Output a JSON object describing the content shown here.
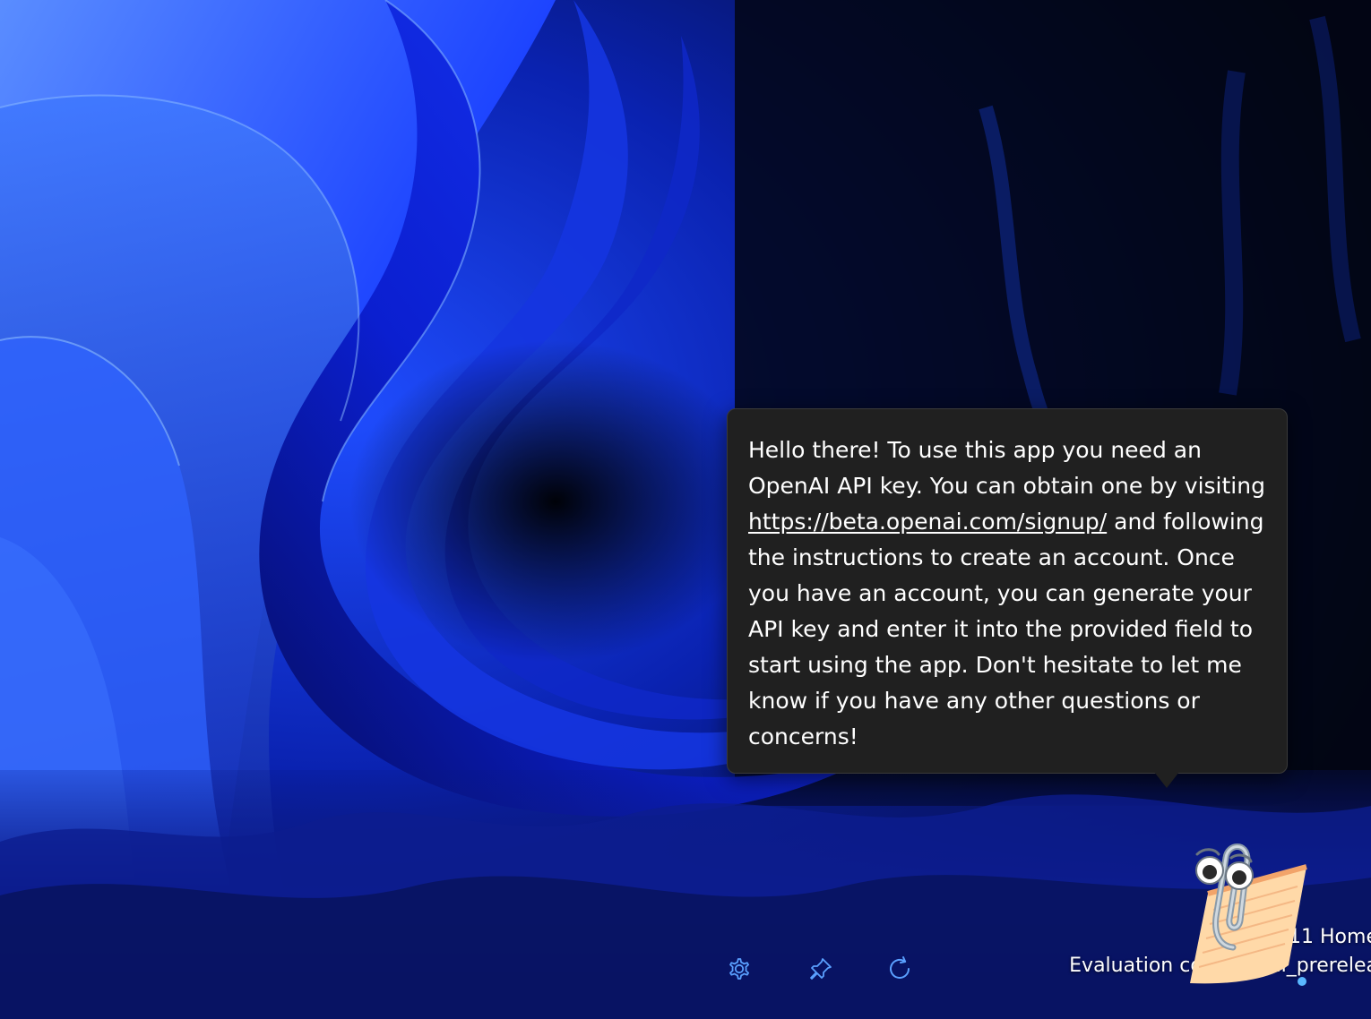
{
  "assistant": {
    "message_part1": "Hello there! To use this app you need an OpenAI API key. You can obtain one by visiting ",
    "link_text": "https://beta.openai.com/signup/",
    "message_part2": " and following the instructions to create an account. Once you have an account, you can generate your API key and enter it into the provided field to start using the app. Don't hesitate to let me know if you have any other questions or concerns!"
  },
  "toolbar": {
    "settings_icon": "gear-icon",
    "pin_icon": "pin-icon",
    "refresh_icon": "refresh-icon"
  },
  "watermark": {
    "line1": "11 Home",
    "line2": "Evaluation copy. Bu        ni_prerelea"
  },
  "colors": {
    "bubble_bg": "#202020",
    "accent_blue": "#1a4cff",
    "icon_blue": "#5aa0ff"
  }
}
